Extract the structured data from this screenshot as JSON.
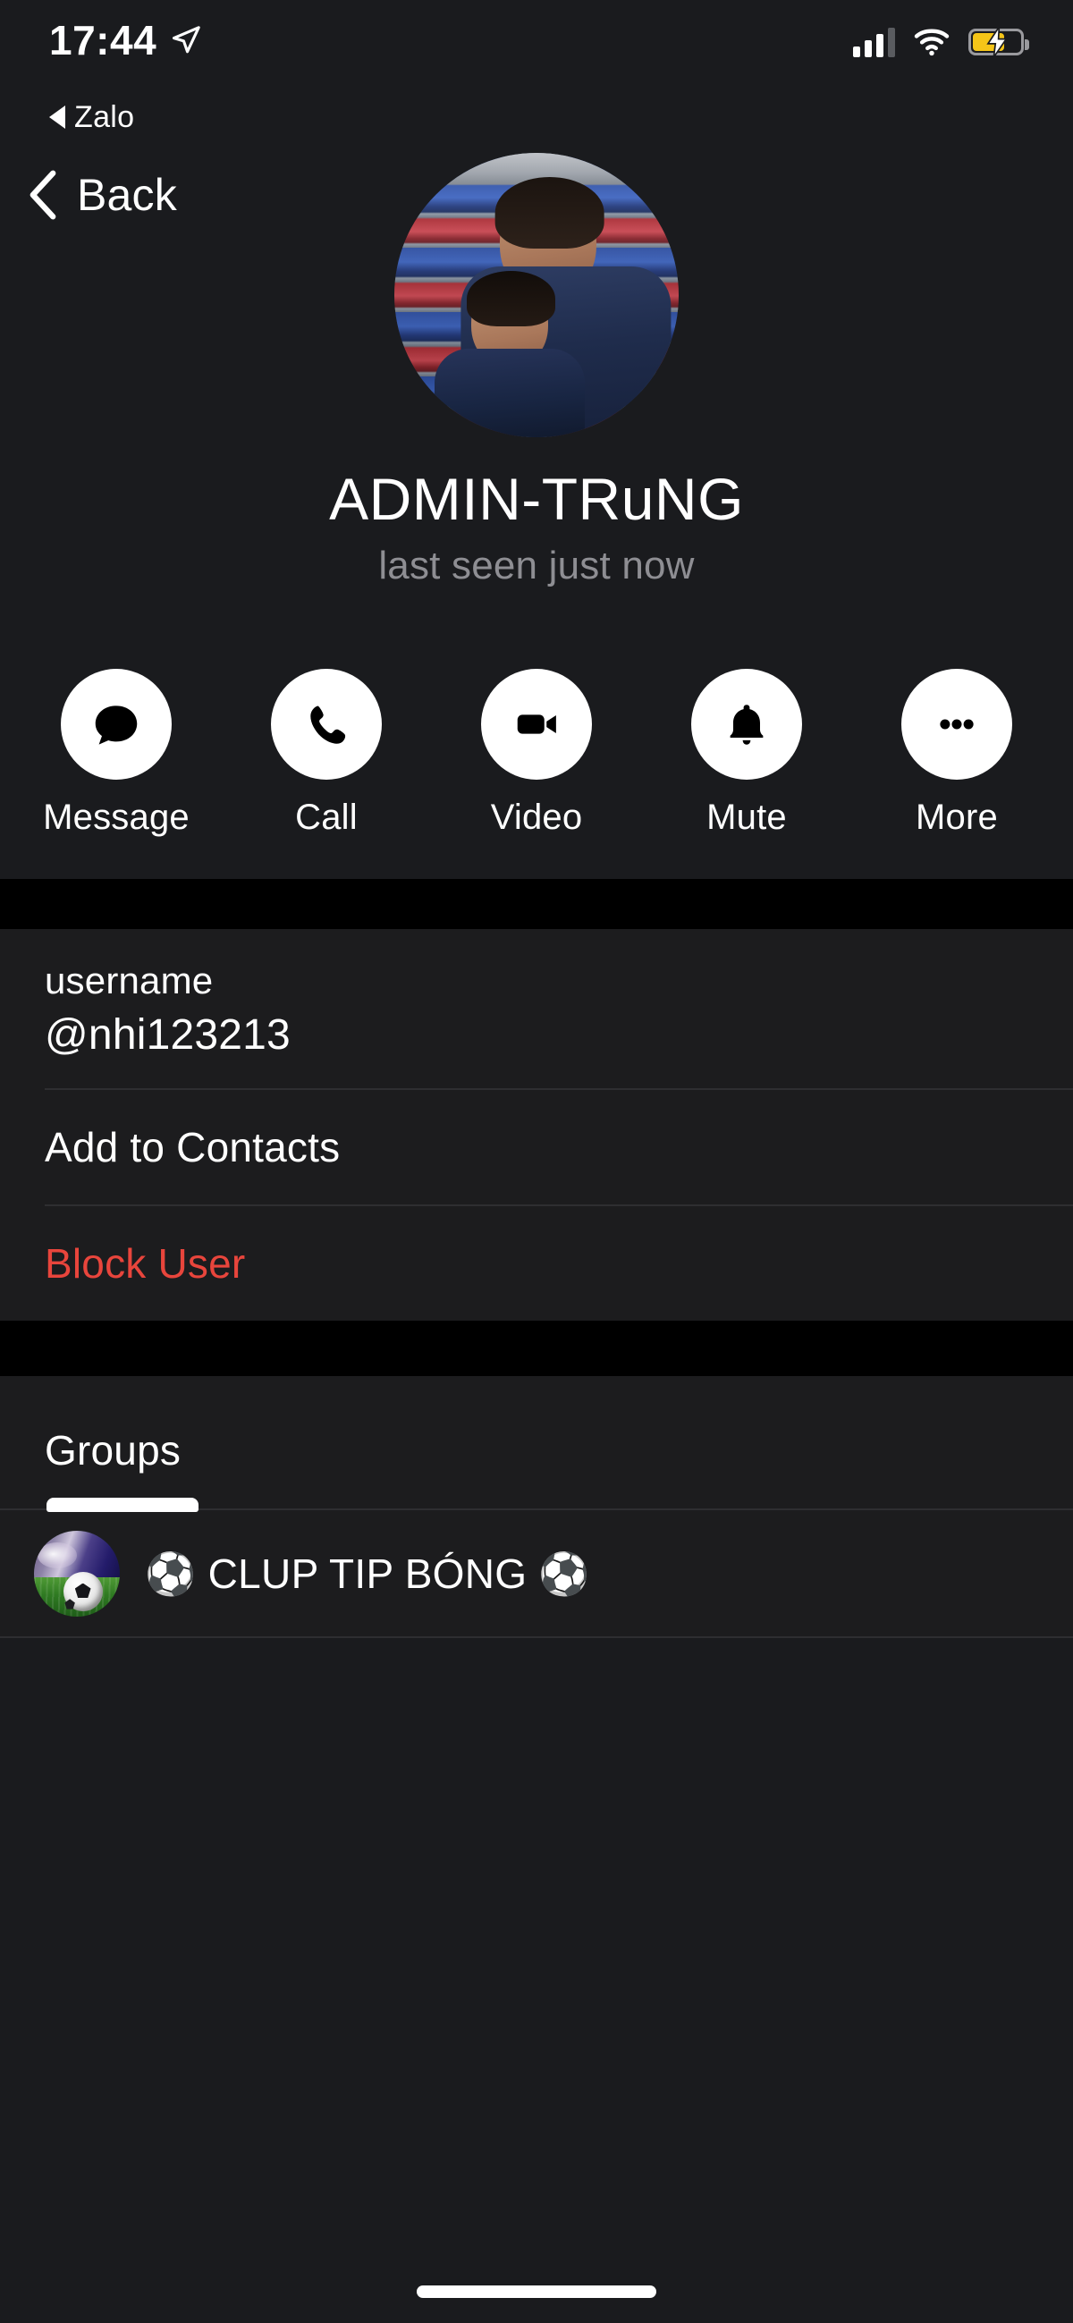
{
  "status_bar": {
    "time": "17:44",
    "location_icon": "location-arrow-icon",
    "signal_icon": "cellular-signal-icon",
    "wifi_icon": "wifi-icon",
    "battery_icon": "battery-charging-icon",
    "battery_color": "#f5c518",
    "signal_bars_filled": 3,
    "signal_bars_total": 4
  },
  "return_to_app": {
    "label": "Zalo",
    "icon": "back-triangle-icon"
  },
  "nav": {
    "back_label": "Back",
    "back_icon": "chevron-left-icon"
  },
  "profile": {
    "avatar_name": "profile-photo",
    "display_name": "ADMIN-TRuNG",
    "status": "last seen just now",
    "status_color": "#8e8e93"
  },
  "actions": [
    {
      "label": "Message",
      "icon": "chat-bubble-icon"
    },
    {
      "label": "Call",
      "icon": "phone-icon"
    },
    {
      "label": "Video",
      "icon": "video-camera-icon"
    },
    {
      "label": "Mute",
      "icon": "bell-icon"
    },
    {
      "label": "More",
      "icon": "ellipsis-icon"
    }
  ],
  "info_section": {
    "username_label": "username",
    "username_value": "@nhi123213",
    "add_to_contacts": "Add to Contacts",
    "block_user": "Block User",
    "block_user_color": "#e8453c"
  },
  "groups_section": {
    "title": "Groups",
    "items": [
      {
        "name": "⚽ CLUP TIP BÓNG ⚽",
        "avatar": "soccer-field-avatar"
      }
    ]
  },
  "home_indicator": "home-indicator-bar",
  "theme": {
    "background": "#1a1b1e",
    "card_background": "#1c1c1e",
    "separator_band": "#000000",
    "divider": "#2e2e31",
    "text_primary": "#ffffff"
  }
}
